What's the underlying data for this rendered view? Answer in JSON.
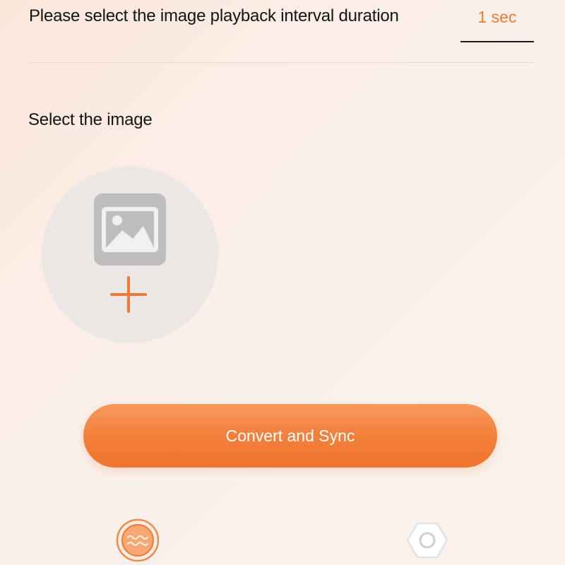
{
  "interval": {
    "label": "Please select the image playback interval duration",
    "value": "1 sec"
  },
  "image_section": {
    "label": "Select the image",
    "picker_icons": [
      "image-icon",
      "plus-icon"
    ]
  },
  "actions": {
    "convert_label": "Convert and Sync"
  },
  "bottom_nav": {
    "items": [
      {
        "icon": "home-wave-icon",
        "active": true
      },
      {
        "icon": "settings-hexagon-icon",
        "active": false
      }
    ]
  },
  "colors": {
    "accent": "#f07a35",
    "button_gradient_top": "#f69a5e",
    "button_gradient_bottom": "#f0742c",
    "picker_bg": "#ebe7e5",
    "image_icon": "#bdbdbd"
  }
}
